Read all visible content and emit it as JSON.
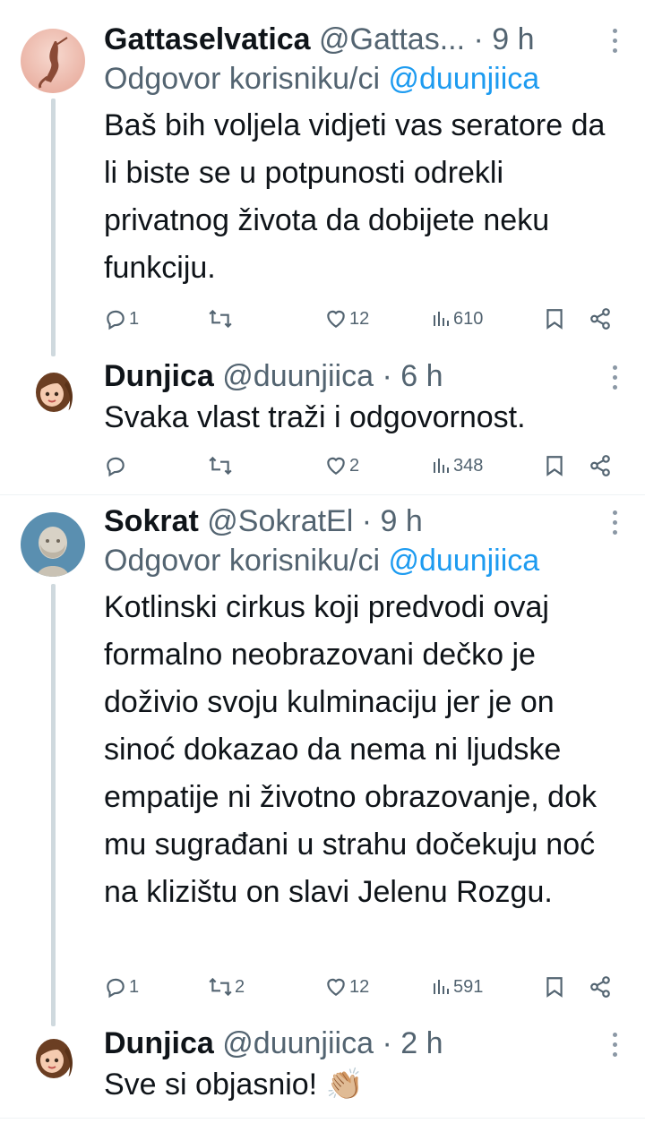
{
  "tweets": [
    {
      "name": "Gattaselvatica",
      "handle": "@Gattas...",
      "time": "9 h",
      "reply_label": "Odgovor korisniku/ci",
      "reply_to": "@duunjiica",
      "text": "Baš bih voljela vidjeti vas seratore da li biste se u potpunosti odrekli privatnog života da dobijete neku funkciju.",
      "replies": "1",
      "retweets": "",
      "likes": "12",
      "views": "610"
    },
    {
      "name": "Dunjica",
      "handle": "@duunjiica",
      "time": "6 h",
      "text": "Svaka vlast traži i odgovornost.",
      "replies": "",
      "retweets": "",
      "likes": "2",
      "views": "348"
    },
    {
      "name": "Sokrat",
      "handle": "@SokratEl",
      "time": "9 h",
      "reply_label": "Odgovor korisniku/ci",
      "reply_to": "@duunjiica",
      "text": "Kotlinski cirkus koji predvodi ovaj formalno neobrazovani dečko je doživio svoju kulminaciju jer je on sinoć dokazao da nema ni ljudske empatije ni životno obrazovanje, dok mu sugrađani u strahu dočekuju noć na klizištu on slavi Jelenu Rozgu.",
      "replies": "1",
      "retweets": "2",
      "likes": "12",
      "views": "591"
    },
    {
      "name": "Dunjica",
      "handle": "@duunjiica",
      "time": "2 h",
      "text": "Sve si objasnio! 👏🏼"
    }
  ],
  "separator": " · ",
  "icons": {
    "reply": "reply-icon",
    "retweet": "retweet-icon",
    "like": "heart-icon",
    "views": "views-icon",
    "bookmark": "bookmark-icon",
    "share": "share-icon",
    "more": "more-icon"
  },
  "colors": {
    "mention": "#1d9bf0",
    "meta": "#536471",
    "thread_line": "#cfd9de"
  }
}
